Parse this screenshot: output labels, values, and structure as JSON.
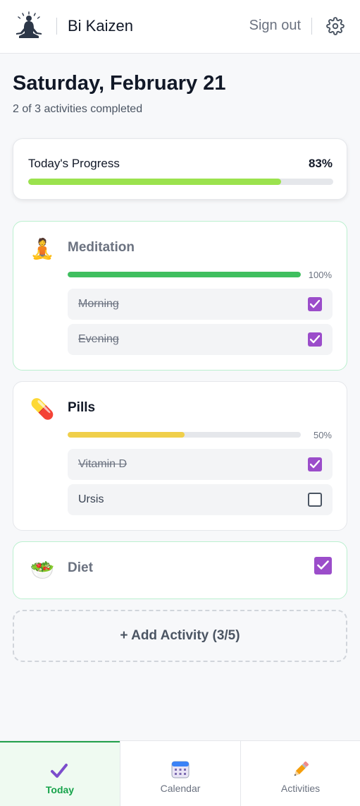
{
  "header": {
    "brand": "Bi Kaizen",
    "sign_out": "Sign out",
    "logo_icon": "meditating-figure-logo",
    "settings_icon": "gear-icon"
  },
  "page": {
    "title": "Saturday, February 21",
    "subtitle": "2 of 3 activities completed"
  },
  "progress": {
    "label": "Today's Progress",
    "percent_text": "83%",
    "fraction": 0.83,
    "color": "#9be24e"
  },
  "activities": [
    {
      "name": "Meditation",
      "icon": "🧘",
      "percent_text": "100%",
      "fraction": 1.0,
      "bar_color": "#3fbf5f",
      "items": [
        {
          "label": "Morning",
          "checked": true
        },
        {
          "label": "Evening",
          "checked": true
        }
      ]
    },
    {
      "name": "Pills",
      "icon": "💊",
      "percent_text": "50%",
      "fraction": 0.5,
      "bar_color": "#f0cf4a",
      "items": [
        {
          "label": "Vitamin D",
          "checked": true
        },
        {
          "label": "Ursis",
          "checked": false
        }
      ]
    },
    {
      "name": "Diet",
      "icon": "🥗",
      "checked": true
    }
  ],
  "add_activity": "+ Add Activity (3/5)",
  "nav": [
    {
      "label": "Today",
      "icon": "checkmark-icon",
      "active": true
    },
    {
      "label": "Calendar",
      "icon": "calendar-icon",
      "active": false
    },
    {
      "label": "Activities",
      "icon": "pencil-icon",
      "active": false
    }
  ],
  "colors": {
    "checkbox": "#9b4dca",
    "active_nav": "#16a34a"
  }
}
